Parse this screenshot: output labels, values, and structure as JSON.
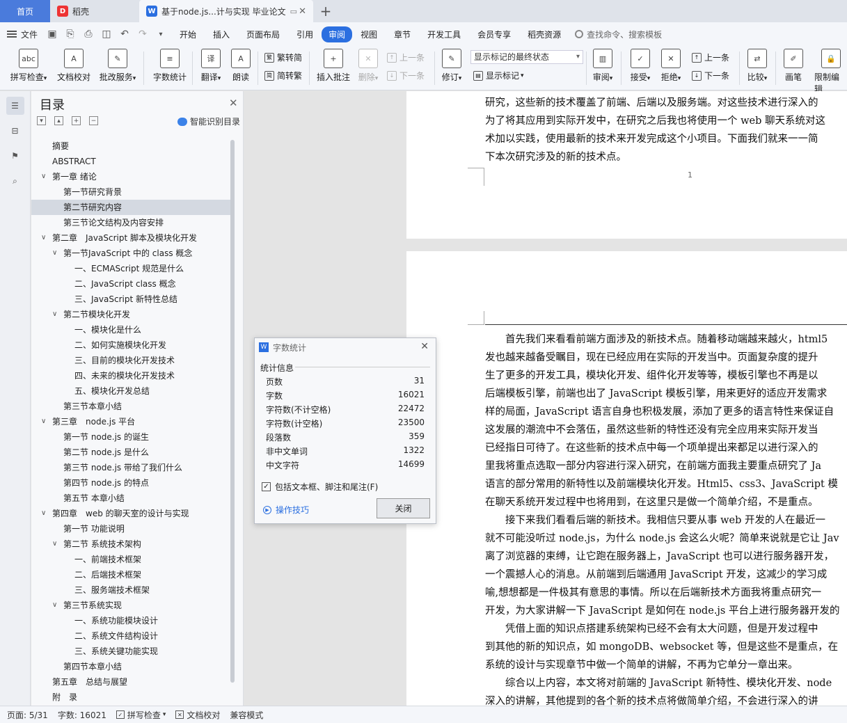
{
  "tabs": {
    "home": "首页",
    "daoke": "稻壳",
    "doc": "基于node.js...计与实现 毕业论文"
  },
  "menu": {
    "file": "文件",
    "items": [
      "开始",
      "插入",
      "页面布局",
      "引用",
      "审阅",
      "视图",
      "章节",
      "开发工具",
      "会员专享",
      "稻壳资源"
    ],
    "active": "审阅",
    "search": "查找命令、搜索模板"
  },
  "ribbon": {
    "spellcheck": "拼写检查",
    "doccheck": "文档校对",
    "batch": "批改服务",
    "wordcount": "字数统计",
    "translate": "翻译",
    "read": "朗读",
    "to_trad": "繁转简",
    "to_simp": "简转繁",
    "insert_comment": "插入批注",
    "delete": "删除",
    "prev": "上一条",
    "next": "下一条",
    "revise": "修订",
    "markup_select": "显示标记的最终状态",
    "show_markup": "显示标记",
    "review": "审阅",
    "accept": "接受",
    "reject": "拒绝",
    "prev2": "上一条",
    "next2": "下一条",
    "compare": "比较",
    "draw": "画笔",
    "restrict": "限制编辑"
  },
  "toc": {
    "title": "目录",
    "smart": "智能识别目录",
    "items": [
      {
        "label": "摘要",
        "level": 1,
        "arrow": false
      },
      {
        "label": "ABSTRACT",
        "level": 1,
        "arrow": false
      },
      {
        "label": "第一章 绪论",
        "level": 1,
        "arrow": true
      },
      {
        "label": "第一节研究背景",
        "level": 2,
        "arrow": false
      },
      {
        "label": "第二节研究内容",
        "level": 2,
        "arrow": false,
        "selected": true
      },
      {
        "label": "第三节论文结构及内容安排",
        "level": 2,
        "arrow": false
      },
      {
        "label": "第二章　JavaScript 脚本及模块化开发",
        "level": 1,
        "arrow": true
      },
      {
        "label": "第一节JavaScript 中的 class 概念",
        "level": 2,
        "arrow": true
      },
      {
        "label": "一、ECMAScript 规范是什么",
        "level": 3,
        "arrow": false
      },
      {
        "label": "二、JavaScript class 概念",
        "level": 3,
        "arrow": false
      },
      {
        "label": "三、JavaScript 新特性总结",
        "level": 3,
        "arrow": false
      },
      {
        "label": "第二节模块化开发",
        "level": 2,
        "arrow": true
      },
      {
        "label": "一、模块化是什么",
        "level": 3,
        "arrow": false
      },
      {
        "label": "二、如何实施模块化开发",
        "level": 3,
        "arrow": false
      },
      {
        "label": "三、目前的模块化开发技术",
        "level": 3,
        "arrow": false
      },
      {
        "label": "四、未来的模块化开发技术",
        "level": 3,
        "arrow": false
      },
      {
        "label": "五、模块化开发总结",
        "level": 3,
        "arrow": false
      },
      {
        "label": "第三节本章小结",
        "level": 2,
        "arrow": false
      },
      {
        "label": "第三章　node.js 平台",
        "level": 1,
        "arrow": true
      },
      {
        "label": "第一节 node.js 的诞生",
        "level": 2,
        "arrow": false
      },
      {
        "label": "第二节 node.js 是什么",
        "level": 2,
        "arrow": false
      },
      {
        "label": "第三节 node.js 带给了我们什么",
        "level": 2,
        "arrow": false
      },
      {
        "label": "第四节 node.js 的特点",
        "level": 2,
        "arrow": false
      },
      {
        "label": "第五节 本章小结",
        "level": 2,
        "arrow": false
      },
      {
        "label": "第四章　web 的聊天室的设计与实现",
        "level": 1,
        "arrow": true
      },
      {
        "label": "第一节 功能说明",
        "level": 2,
        "arrow": false
      },
      {
        "label": "第二节 系统技术架构",
        "level": 2,
        "arrow": true
      },
      {
        "label": "一、前端技术框架",
        "level": 3,
        "arrow": false
      },
      {
        "label": "二、后端技术框架",
        "level": 3,
        "arrow": false
      },
      {
        "label": "三、服务端技术框架",
        "level": 3,
        "arrow": false
      },
      {
        "label": "第三节系统实现",
        "level": 2,
        "arrow": true
      },
      {
        "label": "一、系统功能模块设计",
        "level": 3,
        "arrow": false
      },
      {
        "label": "二、系统文件结构设计",
        "level": 3,
        "arrow": false
      },
      {
        "label": "三、系统关键功能实现",
        "level": 3,
        "arrow": false
      },
      {
        "label": "第四节本章小结",
        "level": 2,
        "arrow": false
      },
      {
        "label": "第五章　总结与展望",
        "level": 1,
        "arrow": false
      },
      {
        "label": "附　录",
        "level": 1,
        "arrow": false
      }
    ]
  },
  "page1": {
    "lines": [
      "研究，这些新的技术覆盖了前端、后端以及服务端。对这些技术进行深入的",
      "为了将其应用到实际开发中，在研究之后我也将使用一个 web 聊天系统对这",
      "术加以实践，使用最新的技术来开发完成这个小项目。下面我们就来一一简",
      "下本次研究涉及的新的技术点。"
    ],
    "page_number": "1"
  },
  "page2": {
    "lines": [
      "　　首先我们来看看前端方面涉及的新技术点。随着移动端越来越火，html5",
      "发也越来越备受瞩目，现在已经应用在实际的开发当中。页面复杂度的提升",
      "生了更多的开发工具，模块化开发、组件化开发等等，模板引擎也不再是以",
      "后端模板引擎，前端也出了 JavaScript 模板引擎，用来更好的适应开发需求",
      "样的局面，JavaScript 语言自身也积极发展，添加了更多的语言特性来保证自",
      "这发展的潮流中不会落伍，虽然这些新的特性还没有完全应用来实际开发当",
      "已经指日可待了。在这些新的技术点中每一个项单提出来都足以进行深入的",
      "里我将重点选取一部分内容进行深入研究，在前端方面我主要重点研究了 Ja",
      "语言的部分常用的新特性以及前端模块化开发。Html5、css3、JavaScript 模",
      "在聊天系统开发过程中也将用到，在这里只是做一个简单介绍，不是重点。",
      "　　接下来我们看看后端的新技术。我相信只要从事 web 开发的人在最近一",
      "就不可能没听过 node.js，为什么 node.js 会这么火呢？简单来说就是它让 Jav",
      "离了浏览器的束缚，让它跑在服务器上，JavaScript 也可以进行服务器开发，",
      "一个震撼人心的消息。从前端到后端通用 JavaScript 开发，这减少的学习成",
      "喻,想想都是一件极其有意思的事情。所以在后端新技术方面我将重点研究一",
      "开发，为大家讲解一下 JavaScript 是如何在 node.js 平台上进行服务器开发的",
      "　　凭借上面的知识点搭建系统架构已经不会有太大问题，但是开发过程中",
      "到其他的新的知识点，如 mongoDB、websocket 等，但是这些不是重点，在",
      "系统的设计与实现章节中做一个简单的讲解，不再为它单分一章出来。",
      "　　综合以上内容，本文将对前端的 JavaScript 新特性、模块化开发、node",
      "深入的讲解，其他提到的各个新的技术点将做简单介绍，不会进行深入的讲",
      "综合应用这些新的技术点来实现一个基于 web 的聊天系统，对此系统的实现"
    ]
  },
  "dialog": {
    "title": "字数统计",
    "section": "统计信息",
    "rows": [
      {
        "label": "页数",
        "value": "31"
      },
      {
        "label": "字数",
        "value": "16021"
      },
      {
        "label": "字符数(不计空格)",
        "value": "22472"
      },
      {
        "label": "字符数(计空格)",
        "value": "23500"
      },
      {
        "label": "段落数",
        "value": "359"
      },
      {
        "label": "非中文单词",
        "value": "1322"
      },
      {
        "label": "中文字符",
        "value": "14699"
      }
    ],
    "checkbox_label": "包括文本框、脚注和尾注(F)",
    "checked": true,
    "tips": "操作技巧",
    "close": "关闭"
  },
  "status": {
    "page": "页面: 5/31",
    "words": "字数: 16021",
    "spell": "拼写检查",
    "doccheck": "文档校对",
    "compat": "兼容模式"
  },
  "colors": {
    "accent": "#2b6fe0",
    "home_tab": "#4a7bdc"
  }
}
